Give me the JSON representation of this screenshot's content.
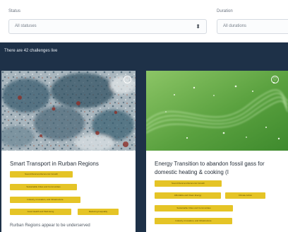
{
  "filters": {
    "status": {
      "label": "Status",
      "value": "All statuses"
    },
    "duration": {
      "label": "Duration",
      "value": "All durations"
    }
  },
  "results": {
    "count_text": "There are 42 challenges live"
  },
  "cards": [
    {
      "title": "Smart Transport in Rurban Regions",
      "tags": [
        "Sound Rural and Economic Growth",
        "Sustainable Cities and Communities",
        "Industry, Innovation, and Infrastructure",
        "Good Health and Well-being",
        "Reducing Inequality"
      ],
      "description": "Rurban Regions appear to be underserved"
    },
    {
      "title": "Energy Transition to abandon fossil gass for domestic heating & cooking (I",
      "tags": [
        "Sound Rural and Economic Growth",
        "Affordable and Clean Energy",
        "Climate Action",
        "Sustainable Cities and Communities",
        "Industry, Innovation, and Infrastructure"
      ]
    }
  ],
  "colors": {
    "page_background": "#1e3148",
    "tag_background": "#e5c426"
  }
}
